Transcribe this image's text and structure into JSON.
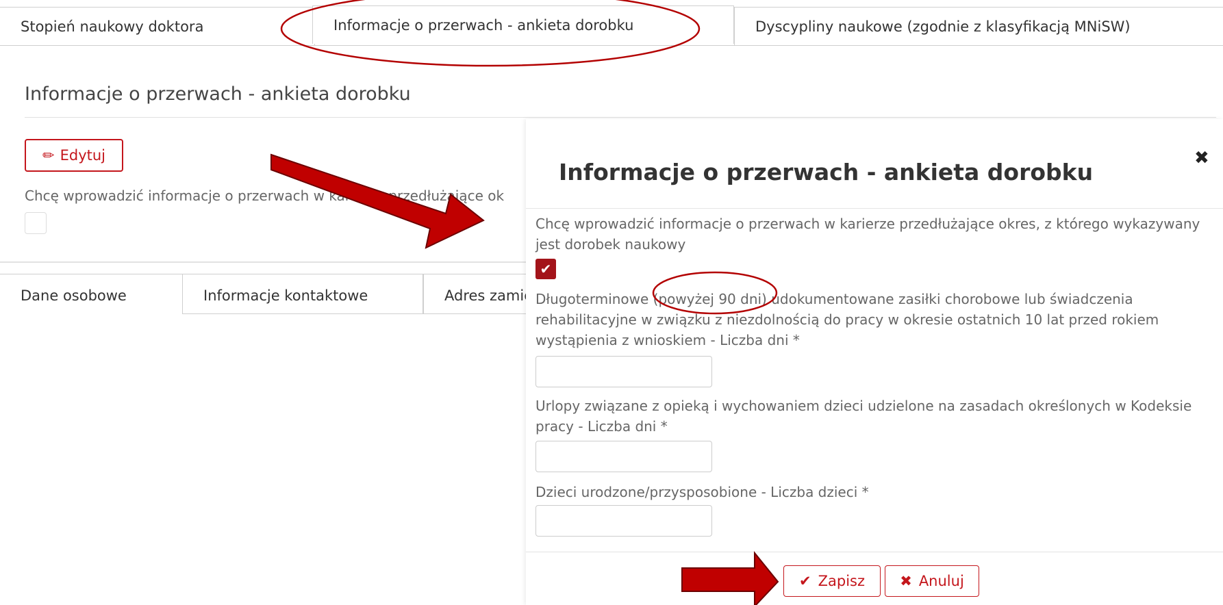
{
  "top_tabs": [
    {
      "label": "Stopień naukowy doktora"
    },
    {
      "label": "Informacje o przerwach - ankieta dorobku"
    },
    {
      "label": "Dyscypliny naukowe (zgodnie z klasyfikacją MNiSW)"
    }
  ],
  "section": {
    "title": "Informacje o przerwach - ankieta dorobku",
    "edit_label": "Edytuj",
    "question_partial": "Chcę wprowadzić informacje o przerwach w karierze przedłużające ok"
  },
  "bottom_tabs": [
    {
      "label": "Dane osobowe"
    },
    {
      "label": "Informacje kontaktowe"
    },
    {
      "label": "Adres zamie"
    }
  ],
  "modal": {
    "title": "Informacje o przerwach - ankieta dorobku",
    "close_symbol": "✖",
    "question": "Chcę wprowadzić informacje o przerwach w karierze przedłużające okres, z którego wykazywany jest dorobek naukowy",
    "checkbox_checked": true,
    "field1_label": "Długoterminowe (powyżej 90 dni) udokumentowane zasiłki chorobowe lub świadczenia rehabilitacyjne w związku z niezdolnością do pracy w okresie ostatnich 10 lat przed rokiem wystąpienia z wnioskiem - Liczba dni *",
    "field1_value": "",
    "field2_label": "Urlopy związane z opieką i wychowaniem dzieci udzielone na zasadach określonych w Kodeksie pracy - Liczba dni *",
    "field2_value": "",
    "field3_label": "Dzieci urodzone/przysposobione - Liczba dzieci *",
    "field3_value": "",
    "save_label": "Zapisz",
    "cancel_label": "Anuluj"
  },
  "icons": {
    "edit": "pencil-icon",
    "check": "check-icon",
    "close": "close-icon",
    "cancel": "x-icon"
  },
  "colors": {
    "accent": "#c4161c",
    "checkbox": "#a3141a",
    "annotation": "#b30000"
  }
}
